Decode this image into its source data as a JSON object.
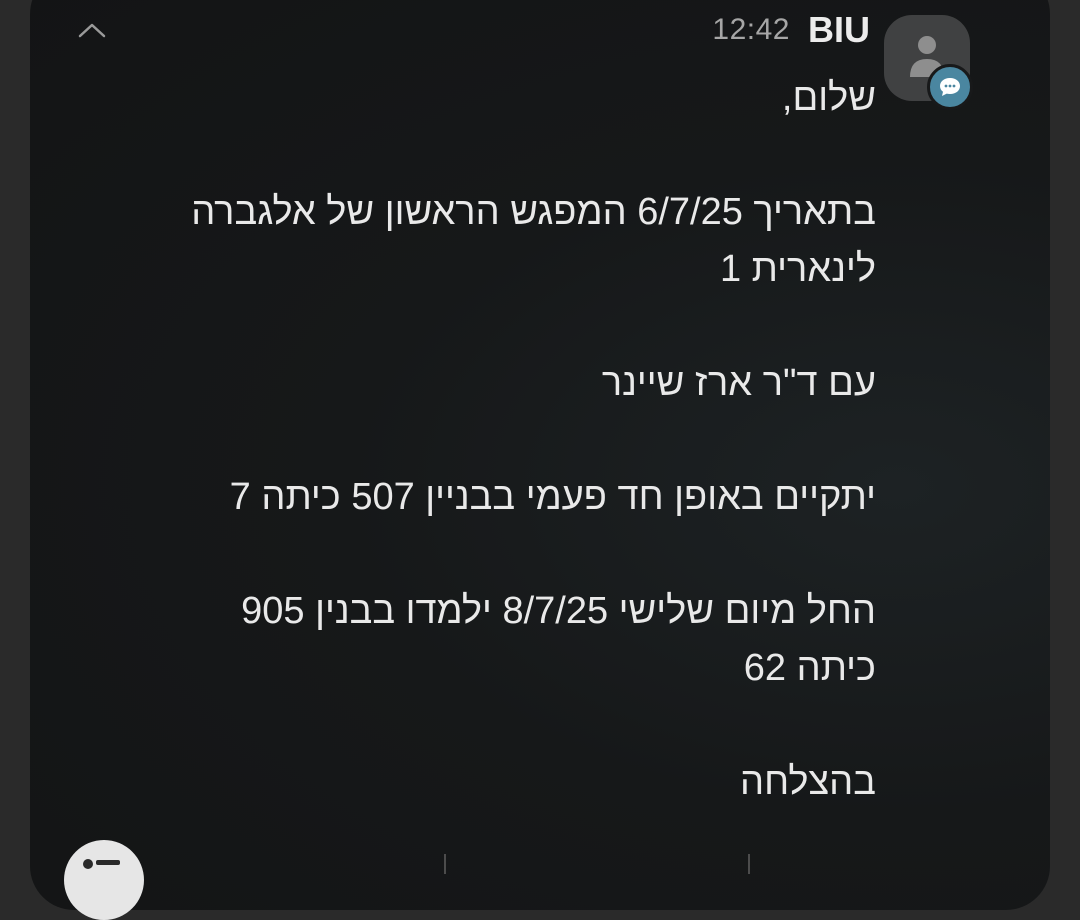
{
  "notification": {
    "sender": "BIU",
    "time": "12:42",
    "message_lines": [
      "שלום,",
      "בתאריך 6/7/25 המפגש הראשון של אלגברה לינארית 1",
      "עם ד\"ר ארז שיינר",
      "יתקיים באופן חד פעמי בבניין 507 כיתה 7",
      "החל מיום שלישי 8/7/25 ילמדו בבנין 905 כיתה 62",
      "בהצלחה"
    ]
  },
  "icons": {
    "collapse": "chevron-up-icon",
    "avatar": "person-icon",
    "badge": "message-bubble-icon",
    "reply": "reply-icon"
  },
  "colors": {
    "background": "#131415",
    "text": "#e9e9e9",
    "time": "#a6a6a6",
    "badge": "#4a86a0"
  }
}
